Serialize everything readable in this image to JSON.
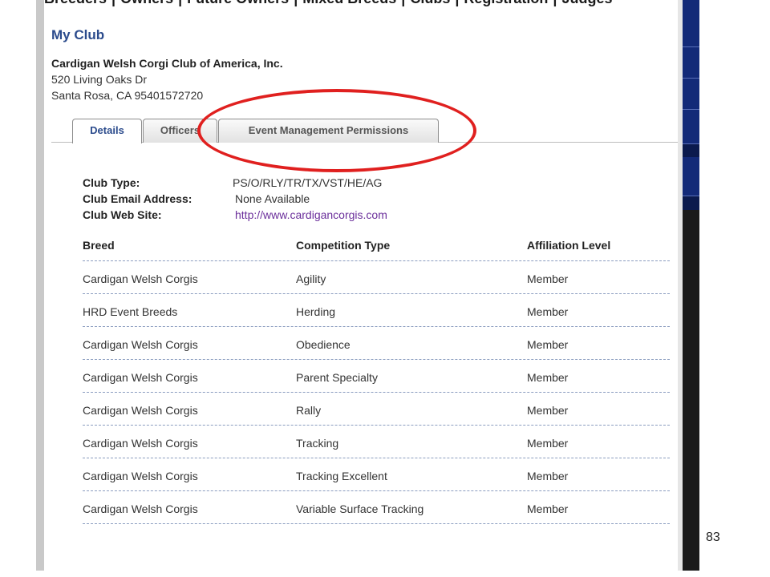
{
  "topnav": {
    "items": [
      "Breeders",
      "Owners",
      "Future Owners",
      "Mixed Breeds",
      "Clubs",
      "Registration",
      "Judges"
    ],
    "separator": "|"
  },
  "page_title": "My Club",
  "club": {
    "name": "Cardigan Welsh Corgi Club of America, Inc.",
    "address_line1": "520 Living Oaks Dr",
    "address_line2": "Santa Rosa, CA 95401572720"
  },
  "tabs": [
    {
      "label": "Details",
      "active": true
    },
    {
      "label": "Officers",
      "active": false
    },
    {
      "label": "Event Management Permissions",
      "active": false
    }
  ],
  "info": {
    "club_type_label": "Club Type:",
    "club_type_value": "PS/O/RLY/TR/TX/VST/HE/AG",
    "email_label": "Club Email Address:",
    "email_value": "None Available",
    "website_label": "Club Web Site:",
    "website_value": "http://www.cardigancorgis.com"
  },
  "table": {
    "headers": {
      "breed": "Breed",
      "competition": "Competition Type",
      "affiliation": "Affiliation Level"
    },
    "rows": [
      {
        "breed": "Cardigan Welsh Corgis",
        "competition": "Agility",
        "affiliation": "Member"
      },
      {
        "breed": "HRD Event Breeds",
        "competition": "Herding",
        "affiliation": "Member"
      },
      {
        "breed": "Cardigan Welsh Corgis",
        "competition": "Obedience",
        "affiliation": "Member"
      },
      {
        "breed": "Cardigan Welsh Corgis",
        "competition": "Parent Specialty",
        "affiliation": "Member"
      },
      {
        "breed": "Cardigan Welsh Corgis",
        "competition": "Rally",
        "affiliation": "Member"
      },
      {
        "breed": "Cardigan Welsh Corgis",
        "competition": "Tracking",
        "affiliation": "Member"
      },
      {
        "breed": "Cardigan Welsh Corgis",
        "competition": "Tracking Excellent",
        "affiliation": "Member"
      },
      {
        "breed": "Cardigan Welsh Corgis",
        "competition": "Variable Surface Tracking",
        "affiliation": "Member"
      }
    ]
  },
  "slide_number": "83",
  "colors": {
    "title_blue": "#2b4b8c",
    "annotation_red": "#e0201f",
    "link_purple": "#6b2f9b",
    "dark_panel": "#0b1a4d"
  }
}
